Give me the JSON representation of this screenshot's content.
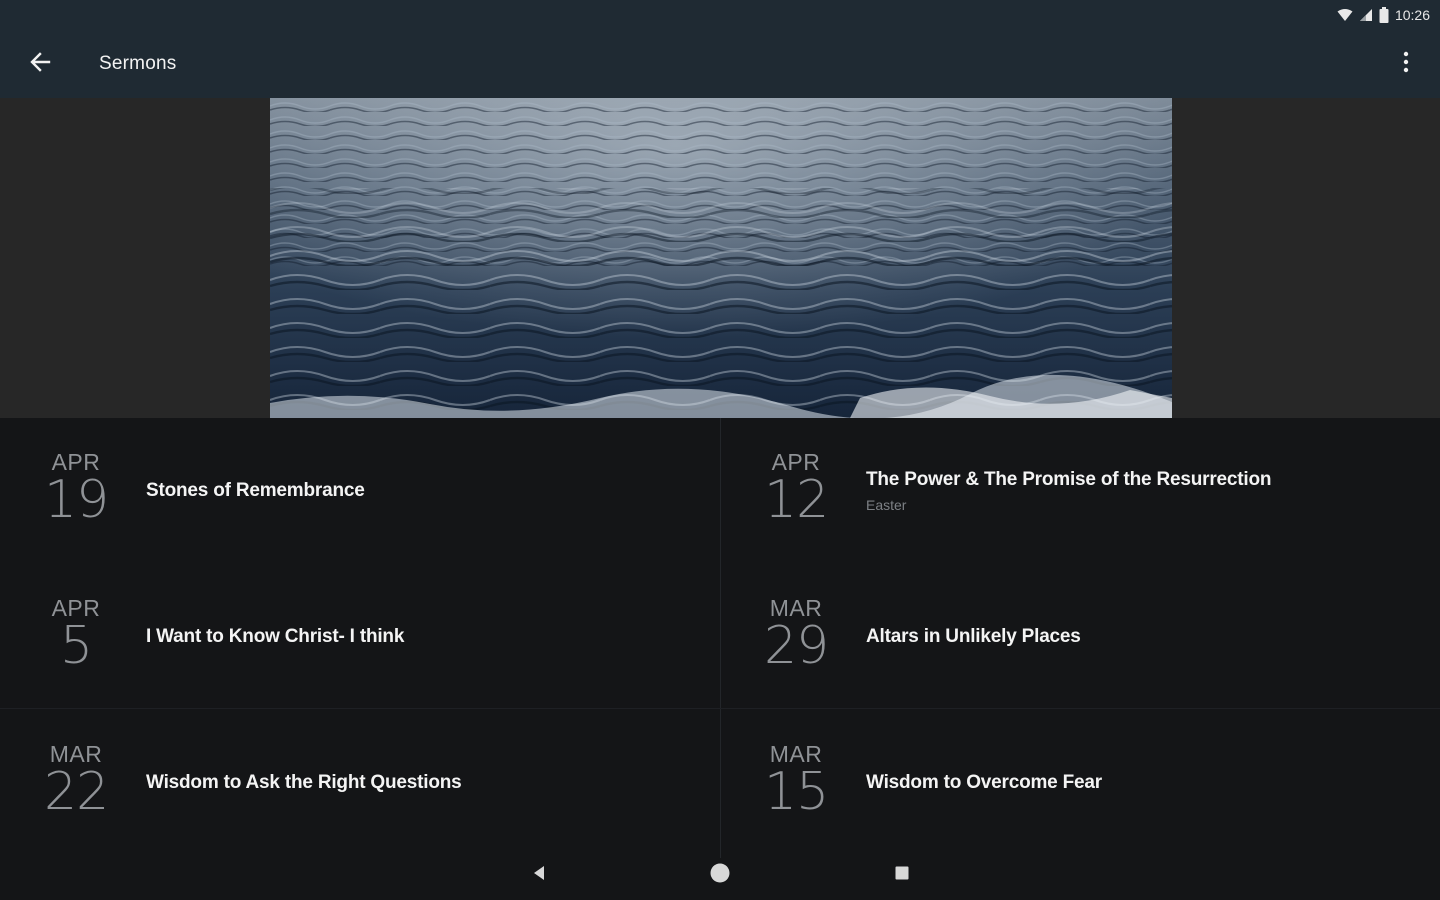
{
  "status_bar": {
    "time": "10:26",
    "icons": [
      "wifi-icon",
      "signal-icon",
      "battery-icon"
    ]
  },
  "app_bar": {
    "title": "Sermons",
    "back_icon": "arrow-left-icon",
    "menu_icon": "more-vert-icon"
  },
  "hero": {
    "image": "ocean-water-photo"
  },
  "sermons": [
    {
      "month": "APR",
      "day": "19",
      "title": "Stones of Remembrance",
      "subtitle": ""
    },
    {
      "month": "APR",
      "day": "12",
      "title": "The Power & The Promise of the Resurrection",
      "subtitle": "Easter"
    },
    {
      "month": "APR",
      "day": "5",
      "title": "I Want to Know Christ- I think",
      "subtitle": ""
    },
    {
      "month": "MAR",
      "day": "29",
      "title": "Altars in Unlikely Places",
      "subtitle": ""
    },
    {
      "month": "MAR",
      "day": "22",
      "title": "Wisdom to Ask the Right Questions",
      "subtitle": ""
    },
    {
      "month": "MAR",
      "day": "15",
      "title": "Wisdom to Overcome Fear",
      "subtitle": ""
    }
  ],
  "nav_bar": {
    "icons": [
      "back-triangle-icon",
      "home-circle-icon",
      "recents-square-icon"
    ]
  },
  "colors": {
    "app_bar": "#1f2a33",
    "background": "#141517",
    "date_text": "#8f9296",
    "title_text": "#f4f4f4"
  }
}
